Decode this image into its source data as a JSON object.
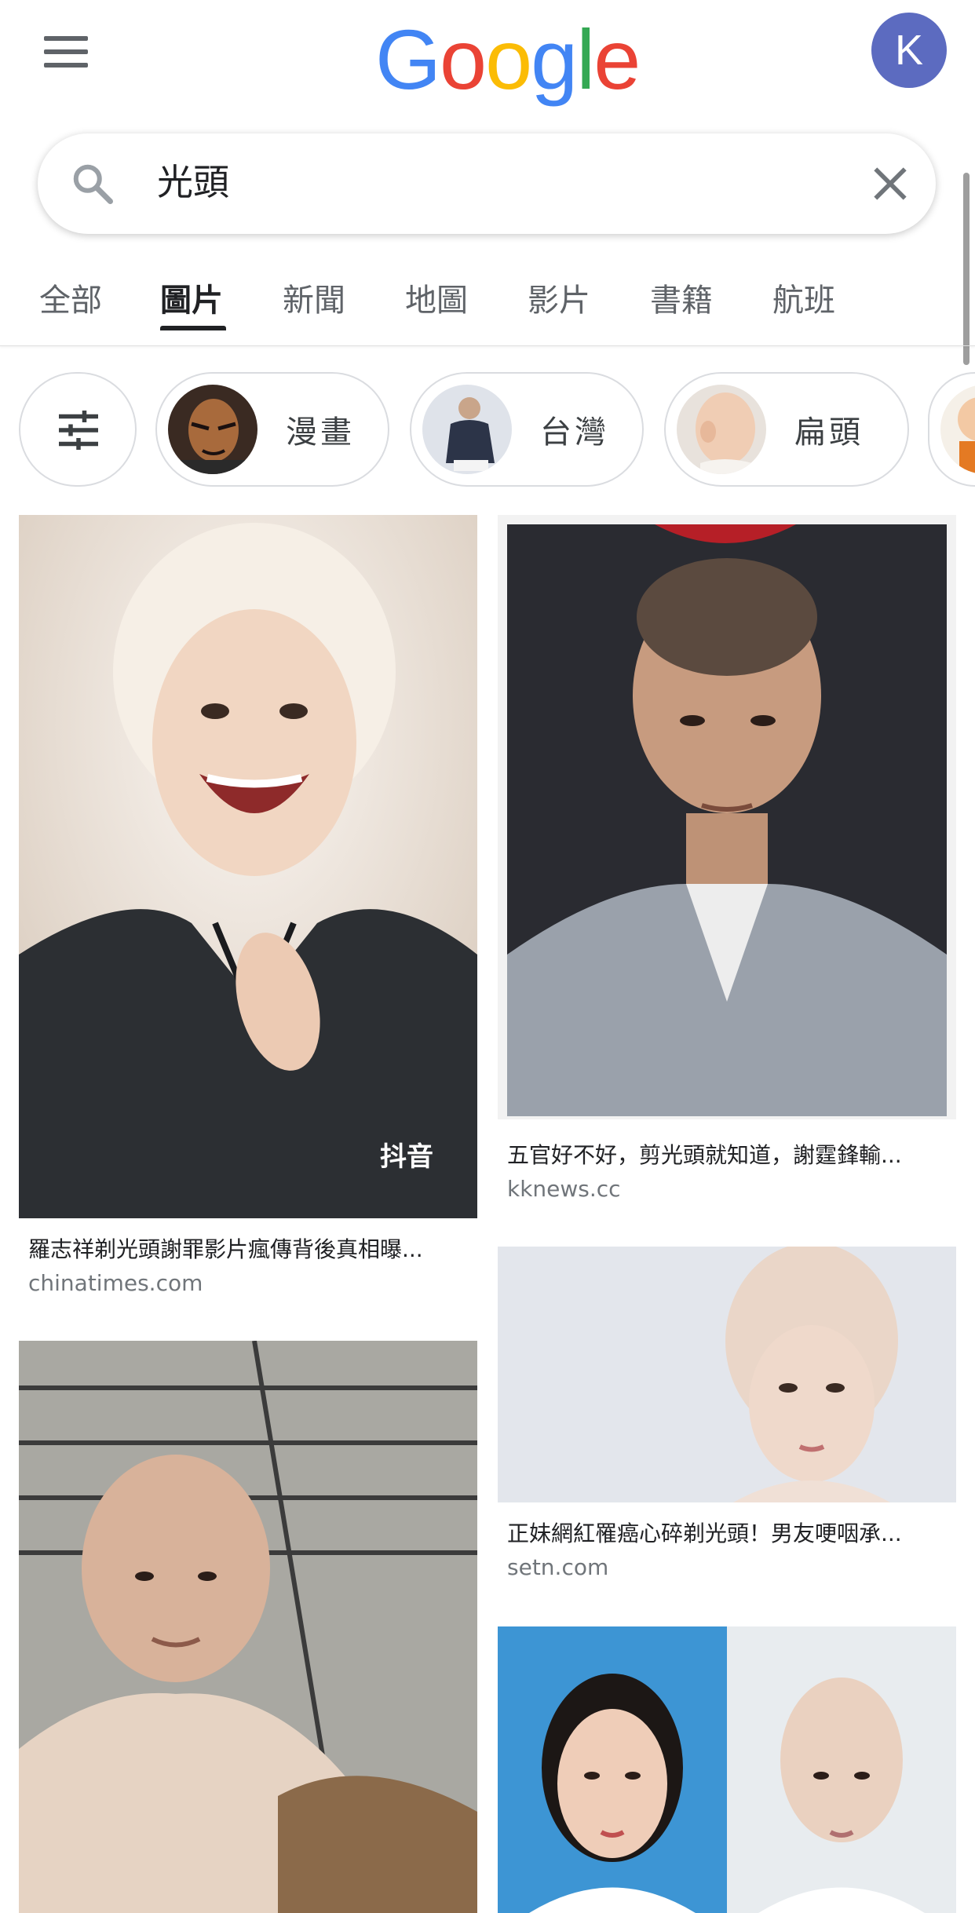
{
  "header": {
    "logo_letters": [
      "G",
      "o",
      "o",
      "g",
      "l",
      "e"
    ],
    "avatar_letter": "K"
  },
  "search": {
    "query": "光頭"
  },
  "tabs": [
    {
      "label": "全部",
      "active": false
    },
    {
      "label": "圖片",
      "active": true
    },
    {
      "label": "新聞",
      "active": false
    },
    {
      "label": "地圖",
      "active": false
    },
    {
      "label": "影片",
      "active": false
    },
    {
      "label": "書籍",
      "active": false
    },
    {
      "label": "航班",
      "active": false
    }
  ],
  "chips": [
    {
      "label": "漫畫",
      "icon": "manga-thumbnail"
    },
    {
      "label": "台灣",
      "icon": "man-suit-thumbnail"
    },
    {
      "label": "扁頭",
      "icon": "baby-head-thumbnail"
    }
  ],
  "results": [
    {
      "caption": "羅志祥剃光頭謝罪影片瘋傳背後真相曝...",
      "domain": "chinatimes.com",
      "watermark": "抖音"
    },
    {
      "caption": "五官好不好，剪光頭就知道，謝霆鋒輸...",
      "domain": "kknews.cc"
    },
    {
      "caption": "正妹網紅罹癌心碎剃光頭！男友哽咽承...",
      "domain": "setn.com"
    },
    {
      "caption": "",
      "domain": ""
    },
    {
      "caption": "",
      "domain": ""
    }
  ],
  "colors": {
    "google_blue": "#4285F4",
    "google_red": "#EA4335",
    "google_yellow": "#FBBC05",
    "google_green": "#34A853",
    "avatar": "#5c6bc0"
  }
}
